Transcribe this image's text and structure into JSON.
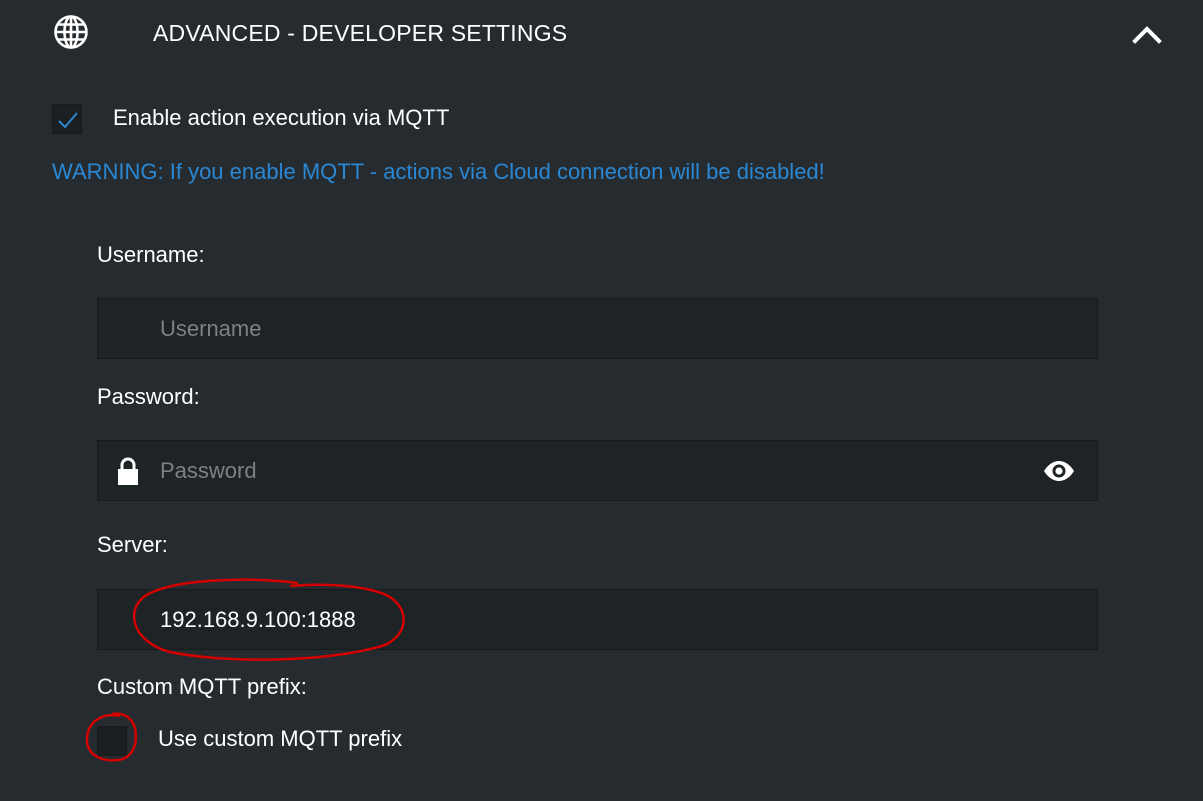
{
  "header": {
    "title": "ADVANCED - DEVELOPER SETTINGS",
    "icon": "globe-icon",
    "collapse_icon": "chevron-up-icon"
  },
  "mqtt": {
    "enable_label": "Enable action execution via MQTT",
    "enabled": true,
    "warning": "WARNING: If you enable MQTT - actions via Cloud connection will be disabled!"
  },
  "username": {
    "label": "Username:",
    "placeholder": "Username",
    "value": ""
  },
  "password": {
    "label": "Password:",
    "placeholder": "Password",
    "value": "",
    "lock_icon": "lock-icon",
    "toggle_icon": "eye-icon"
  },
  "server": {
    "label": "Server:",
    "value": "192.168.9.100:1888"
  },
  "prefix": {
    "label": "Custom MQTT prefix:",
    "checkbox_label": "Use custom MQTT prefix",
    "checked": false
  },
  "colors": {
    "background": "#262b2f",
    "field": "#1e2326",
    "accent": "#2a87d3",
    "annotation": "#d40000"
  }
}
